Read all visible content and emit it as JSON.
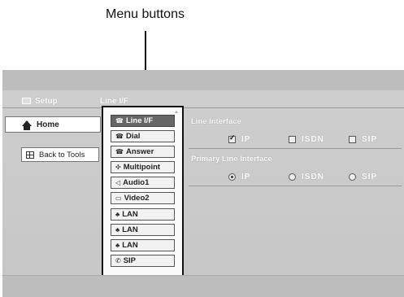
{
  "callout": "Menu buttons",
  "header": {
    "breadcrumb_setup": "Setup",
    "breadcrumb_current": "Line I/F"
  },
  "sidebar": {
    "home_label": "Home",
    "back_label": "Back to Tools"
  },
  "menu": {
    "items": [
      {
        "label": "Line I/F",
        "icon": "☎",
        "selected": true
      },
      {
        "label": "Dial",
        "icon": "☎"
      },
      {
        "label": "Answer",
        "icon": "☎"
      },
      {
        "label": "Multipoint",
        "icon": "✣"
      },
      {
        "label": "Audio1",
        "icon": "◁"
      },
      {
        "label": "Video2",
        "icon": "▭"
      },
      {
        "label": "LAN",
        "icon": "♣"
      },
      {
        "label": "LAN",
        "icon": "♣"
      },
      {
        "label": "LAN",
        "icon": "♣"
      },
      {
        "label": "SIP",
        "icon": "✆"
      }
    ]
  },
  "line_interface": {
    "title": "Line Interface",
    "options": [
      {
        "label": "IP",
        "checked": true
      },
      {
        "label": "ISDN",
        "checked": false
      },
      {
        "label": "SIP",
        "checked": false
      }
    ]
  },
  "primary_line_interface": {
    "title": "Primary Line Interface",
    "options": [
      {
        "label": "IP",
        "selected": true
      },
      {
        "label": "ISDN",
        "selected": false
      },
      {
        "label": "SIP",
        "selected": false
      }
    ]
  }
}
